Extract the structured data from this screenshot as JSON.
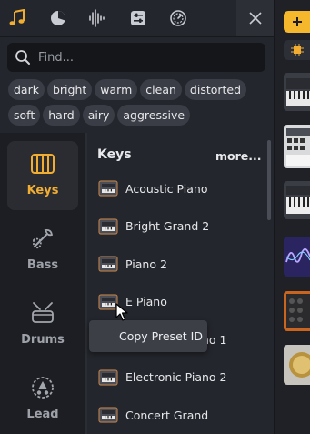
{
  "tabs": [
    {
      "icon": "music-note-icon"
    },
    {
      "icon": "pie-chart-icon"
    },
    {
      "icon": "waveform-icon"
    },
    {
      "icon": "sliders-icon"
    },
    {
      "icon": "gauge-icon"
    }
  ],
  "search": {
    "placeholder": "Find..."
  },
  "tags": [
    "dark",
    "bright",
    "warm",
    "clean",
    "distorted",
    "soft",
    "hard",
    "airy",
    "aggressive"
  ],
  "categories": [
    {
      "label": "Keys",
      "icon": "keys-icon",
      "active": true
    },
    {
      "label": "Bass",
      "icon": "bass-icon",
      "active": false
    },
    {
      "label": "Drums",
      "icon": "drums-icon",
      "active": false
    },
    {
      "label": "Lead",
      "icon": "lead-icon",
      "active": false
    }
  ],
  "list": {
    "heading": "Keys",
    "more_label": "more...",
    "presets": [
      "Acoustic Piano",
      "Bright Grand 2",
      "Piano 2",
      "E Piano",
      "Electronic Piano 1",
      "Electronic Piano 2",
      "Concert Grand"
    ]
  },
  "context_menu": {
    "label": "Copy Preset ID"
  },
  "colors": {
    "accent": "#f0ad32",
    "add_button": "#f5b72b"
  }
}
